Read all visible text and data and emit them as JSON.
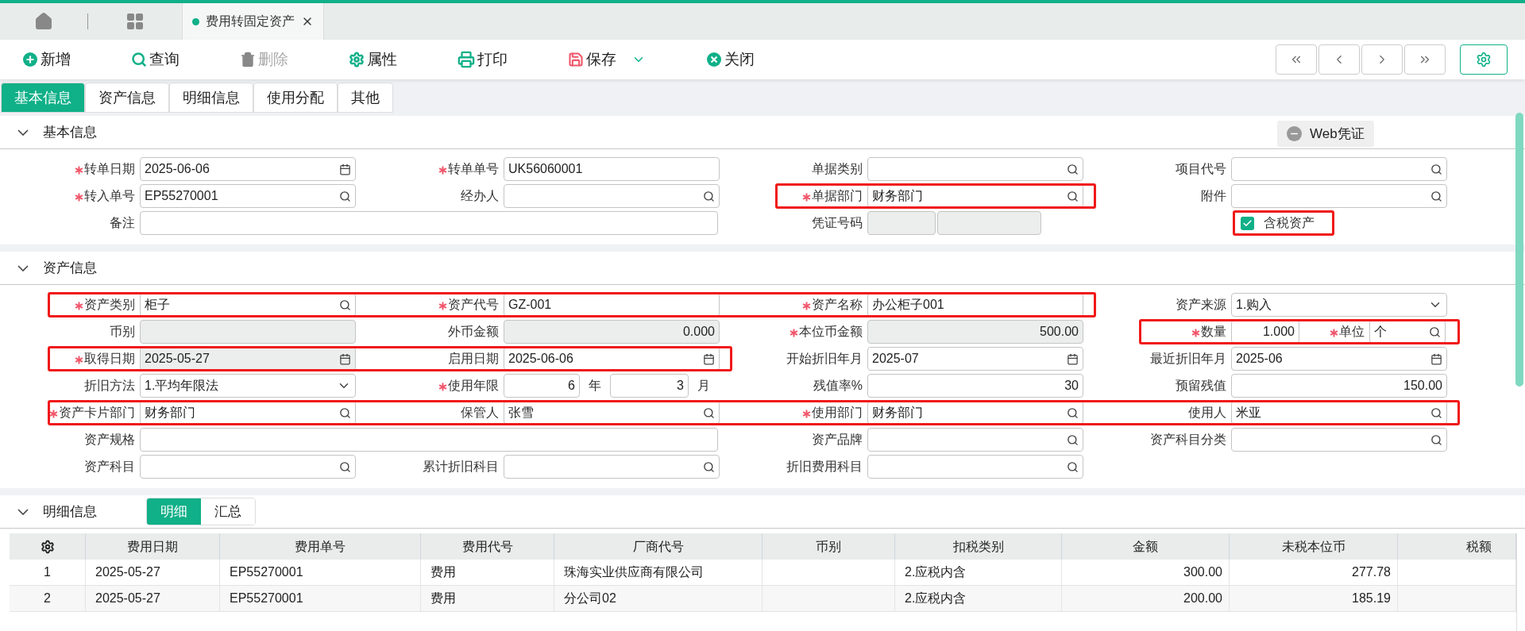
{
  "open_tabs": [
    {
      "label": "费用转固定资产",
      "selected": true
    }
  ],
  "toolbar": [
    {
      "kind": "add",
      "label": "新增",
      "disabled": false,
      "has_menu": false
    },
    {
      "kind": "search",
      "label": "查询",
      "disabled": false,
      "has_menu": false
    },
    {
      "kind": "delete",
      "label": "删除",
      "disabled": true,
      "has_menu": false
    },
    {
      "kind": "properties",
      "label": "属性",
      "disabled": false,
      "has_menu": false
    },
    {
      "kind": "print",
      "label": "打印",
      "disabled": false,
      "has_menu": false
    },
    {
      "kind": "save",
      "label": "保存",
      "disabled": false,
      "has_menu": true
    },
    {
      "kind": "close",
      "label": "关闭",
      "disabled": false,
      "has_menu": false
    }
  ],
  "tabs": [
    {
      "label": "基本信息",
      "selected": true
    },
    {
      "label": "资产信息",
      "selected": false
    },
    {
      "label": "明细信息",
      "selected": false
    },
    {
      "label": "使用分配",
      "selected": false
    },
    {
      "label": "其他",
      "selected": false
    }
  ],
  "sections": [
    {
      "title": "基本信息",
      "expanded": true,
      "button": "Web凭证",
      "rows": [
        [
          {
            "kind": "date",
            "label": "转单日期",
            "required": true,
            "value": "2025-06-06",
            "readonly": false,
            "highlighted": false
          },
          {
            "kind": "text",
            "label": "转单单号",
            "required": true,
            "value": "UK56060001",
            "readonly": false,
            "highlighted": false
          },
          {
            "kind": "search",
            "label": "单据类别",
            "required": false,
            "readonly": false,
            "highlighted": false
          },
          {
            "kind": "search",
            "label": "项目代号",
            "required": false,
            "readonly": false,
            "highlighted": false
          }
        ],
        [
          {
            "kind": "search",
            "label": "转入单号",
            "required": true,
            "value": "EP55270001",
            "readonly": false,
            "highlighted": false
          },
          {
            "kind": "search",
            "label": "经办人",
            "required": false,
            "readonly": false,
            "highlighted": false
          },
          {
            "kind": "search",
            "label": "单据部门",
            "required": true,
            "value": "财务部门",
            "readonly": false,
            "highlighted": true
          },
          {
            "kind": "search",
            "label": "附件",
            "required": false,
            "readonly": false,
            "highlighted": false
          }
        ],
        [
          {
            "kind": "text",
            "label": "备注",
            "required": false,
            "readonly": false,
            "colspan": 2,
            "highlighted": false
          },
          {
            "kind": "double",
            "label": "凭证号码",
            "required": false,
            "readonly": true,
            "highlighted": false
          },
          {
            "kind": "checkbox",
            "label": "含税资产",
            "checked": true,
            "highlighted": true
          }
        ]
      ]
    },
    {
      "title": "资产信息",
      "expanded": true,
      "rows": [
        [
          {
            "kind": "search",
            "label": "资产类别",
            "required": true,
            "value": "柜子",
            "readonly": false,
            "highlighted": true
          },
          {
            "kind": "text",
            "label": "资产代号",
            "required": true,
            "value": "GZ-001",
            "readonly": false,
            "highlighted": true
          },
          {
            "kind": "text",
            "label": "资产名称",
            "required": true,
            "value": "办公柜子001",
            "readonly": false,
            "highlighted": true
          },
          {
            "kind": "select",
            "label": "资产来源",
            "required": false,
            "value": "1.购入",
            "readonly": false,
            "highlighted": false
          }
        ],
        [
          {
            "kind": "text",
            "label": "币别",
            "required": false,
            "readonly": true,
            "highlighted": false
          },
          {
            "kind": "number",
            "label": "外币金额",
            "required": false,
            "value": "0.000",
            "readonly": true,
            "highlighted": false
          },
          {
            "kind": "number",
            "label": "本位币金额",
            "required": true,
            "value": "500.00",
            "readonly": true,
            "highlighted": false
          },
          {
            "kind": "qty_unit",
            "label": "数量",
            "required": true,
            "value": "1.000",
            "unit_label": "单位",
            "unit_required": true,
            "unit_value": "个",
            "highlighted": true
          }
        ],
        [
          {
            "kind": "date",
            "label": "取得日期",
            "required": true,
            "value": "2025-05-27",
            "readonly": true,
            "highlighted": true
          },
          {
            "kind": "date",
            "label": "启用日期",
            "required": false,
            "value": "2025-06-06",
            "readonly": false,
            "highlighted": true
          },
          {
            "kind": "date",
            "label": "开始折旧年月",
            "required": false,
            "value": "2025-07",
            "readonly": false,
            "highlighted": false
          },
          {
            "kind": "date",
            "label": "最近折旧年月",
            "required": false,
            "value": "2025-06",
            "readonly": false,
            "highlighted": false
          }
        ],
        [
          {
            "kind": "select",
            "label": "折旧方法",
            "required": false,
            "value": "1.平均年限法",
            "readonly": false,
            "highlighted": false
          },
          {
            "kind": "years_months",
            "label": "使用年限",
            "required": true,
            "value": "6",
            "unit": "年",
            "value2": "3",
            "unit2": "月",
            "highlighted": false
          },
          {
            "kind": "number",
            "label": "残值率%",
            "required": false,
            "value": "30",
            "readonly": false,
            "highlighted": false
          },
          {
            "kind": "number",
            "label": "预留残值",
            "required": false,
            "value": "150.00",
            "readonly": false,
            "highlighted": false
          }
        ],
        [
          {
            "kind": "search",
            "label": "资产卡片部门",
            "required": true,
            "value": "财务部门",
            "readonly": false,
            "highlighted": true
          },
          {
            "kind": "search",
            "label": "保管人",
            "required": false,
            "value": "张雪",
            "readonly": false,
            "highlighted": true
          },
          {
            "kind": "search",
            "label": "使用部门",
            "required": true,
            "value": "财务部门",
            "readonly": false,
            "highlighted": true
          },
          {
            "kind": "search",
            "label": "使用人",
            "required": false,
            "value": "米亚",
            "readonly": false,
            "highlighted": true
          }
        ],
        [
          {
            "kind": "text",
            "label": "资产规格",
            "required": false,
            "readonly": false,
            "colspan": 2,
            "highlighted": false
          },
          {
            "kind": "search",
            "label": "资产品牌",
            "required": false,
            "readonly": false,
            "highlighted": false
          },
          {
            "kind": "search",
            "label": "资产科目分类",
            "required": false,
            "readonly": false,
            "highlighted": false
          }
        ],
        [
          {
            "kind": "search",
            "label": "资产科目",
            "required": false,
            "readonly": false,
            "highlighted": false
          },
          {
            "kind": "search",
            "label": "累计折旧科目",
            "required": false,
            "readonly": false,
            "highlighted": false
          },
          {
            "kind": "search",
            "label": "折旧费用科目",
            "required": false,
            "readonly": false,
            "highlighted": false
          }
        ]
      ]
    },
    {
      "title": "明细信息",
      "expanded": true,
      "subtabs": [
        {
          "label": "明细",
          "selected": true
        },
        {
          "label": "汇总",
          "selected": false
        }
      ]
    }
  ],
  "table": {
    "columns": [
      {
        "label": "费用日期",
        "kind": "text"
      },
      {
        "label": "费用单号",
        "kind": "text"
      },
      {
        "label": "费用代号",
        "kind": "text"
      },
      {
        "label": "厂商代号",
        "kind": "text"
      },
      {
        "label": "币别",
        "kind": "text"
      },
      {
        "label": "扣税类别",
        "kind": "text"
      },
      {
        "label": "金额",
        "kind": "amount"
      },
      {
        "label": "未税本位币",
        "kind": "amount"
      },
      {
        "label": "税额",
        "kind": "amount"
      }
    ],
    "rows": [
      {
        "index": "1",
        "cells": [
          "2025-05-27",
          "EP55270001",
          "费用",
          "珠海实业供应商有限公司",
          null,
          "2.应税内含",
          "300.00",
          "277.78",
          null
        ]
      },
      {
        "index": "2",
        "cells": [
          "2025-05-27",
          "EP55270001",
          "费用",
          "分公司02",
          null,
          "2.应税内含",
          "200.00",
          "185.19",
          null
        ]
      }
    ]
  }
}
